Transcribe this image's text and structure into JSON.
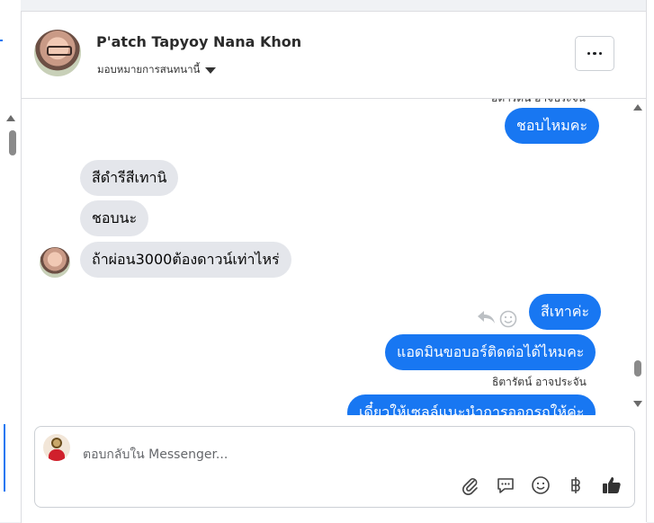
{
  "header": {
    "contact_name": "P'atch Tapyoy Nana Khon",
    "assign_label": "มอบหมายการสนทนานี้"
  },
  "messages": {
    "cut_sender": "ฮิตารัตน์ อาจประจัน",
    "items": [
      {
        "direction": "outgoing",
        "text": "ชอบไหมคะ"
      },
      {
        "direction": "incoming",
        "text": "สีดำรีสีเทานิ"
      },
      {
        "direction": "incoming",
        "text": "ชอบนะ"
      },
      {
        "direction": "incoming",
        "text": "ถ้าผ่อน3000ต้องดาวน์เท่าไหร่"
      },
      {
        "direction": "outgoing",
        "text": "สีเทาค่ะ"
      },
      {
        "direction": "outgoing",
        "text": "แอดมินขอบอร์ติดต่อได้ไหมคะ"
      },
      {
        "direction": "outgoing",
        "text": "เดี๋ยวให้เซลล์แนะนำการออกรถให้ค่ะ"
      }
    ],
    "sender_label": "ธิตารัตน์ อาจประจัน"
  },
  "composer": {
    "placeholder": "ตอบกลับใน Messenger..."
  },
  "icons": {
    "attach": "paperclip-icon",
    "saved_replies": "chat-bubble-icon",
    "emoji": "smile-icon",
    "payment": "baht-icon",
    "like": "thumbs-up-icon"
  },
  "colors": {
    "outgoing_bubble": "#1877f2",
    "incoming_bubble": "#e4e6eb"
  }
}
